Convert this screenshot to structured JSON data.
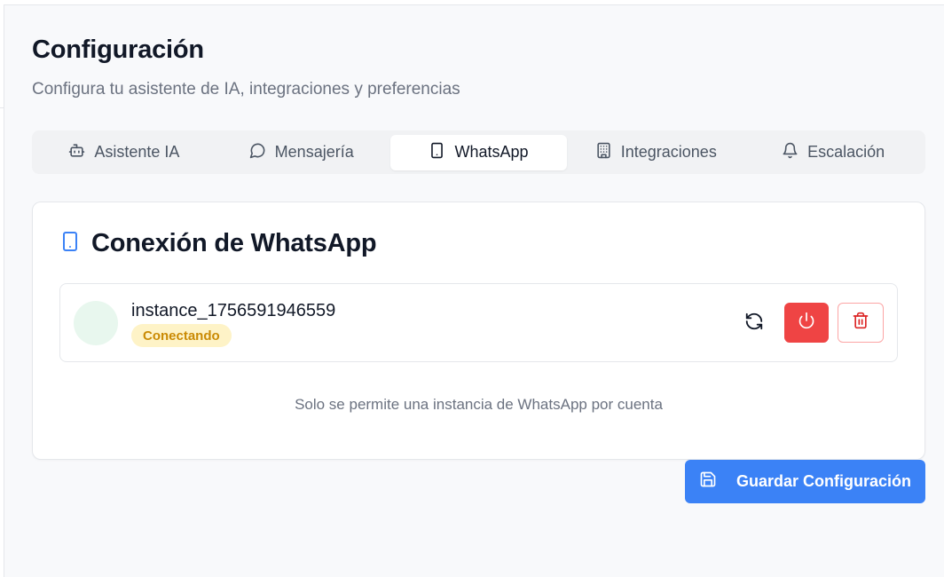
{
  "page": {
    "title": "Configuración",
    "subtitle": "Configura tu asistente de IA, integraciones y preferencias"
  },
  "tabs": [
    {
      "label": "Asistente IA",
      "icon": "bot-icon",
      "active": false
    },
    {
      "label": "Mensajería",
      "icon": "message-circle-icon",
      "active": false
    },
    {
      "label": "WhatsApp",
      "icon": "smartphone-icon",
      "active": true
    },
    {
      "label": "Integraciones",
      "icon": "building-icon",
      "active": false
    },
    {
      "label": "Escalación",
      "icon": "bell-icon",
      "active": false
    }
  ],
  "whatsapp_card": {
    "title": "Conexión de WhatsApp",
    "instance": {
      "name": "instance_1756591946559",
      "status": "Conectando"
    },
    "note": "Solo se permite una instancia de WhatsApp por cuenta"
  },
  "save_button": {
    "label": "Guardar Configuración"
  },
  "colors": {
    "accent_blue": "#3b82f6",
    "danger_red": "#ef4444",
    "status_pending_bg": "#fef3c7",
    "status_pending_text": "#ca8a04"
  }
}
